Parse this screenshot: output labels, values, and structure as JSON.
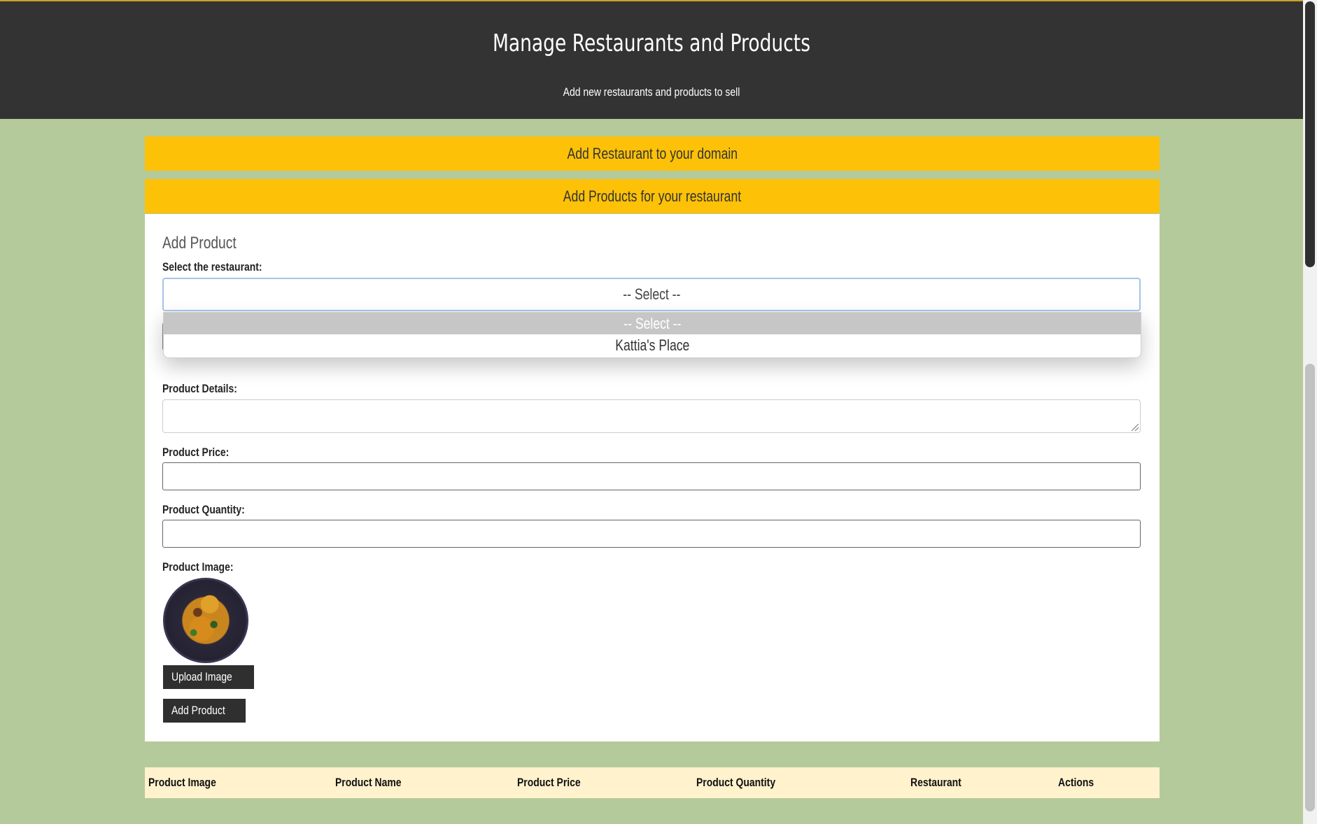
{
  "header": {
    "title": "Manage Restaurants and Products",
    "subtitle": "Add new restaurants and products to sell"
  },
  "accordions": {
    "add_restaurant": "Add Restaurant to your domain",
    "add_products": "Add Products for your restaurant"
  },
  "form": {
    "title": "Add Product",
    "restaurant_label": "Select the restaurant:",
    "restaurant_selected": "-- Select --",
    "restaurant_options": [
      "-- Select --",
      "Kattia's Place"
    ],
    "details_label": "Product Details:",
    "price_label": "Product Price:",
    "quantity_label": "Product Quantity:",
    "image_label": "Product Image:",
    "upload_button": "Upload Image",
    "submit_button": "Add Product"
  },
  "table": {
    "columns": [
      "Product Image",
      "Product Name",
      "Product Price",
      "Product Quantity",
      "Restaurant",
      "Actions"
    ]
  },
  "colors": {
    "header_bg": "#333333",
    "page_bg": "#b5ca9b",
    "accordion_bg": "#fdc108",
    "table_header_bg": "#fff2cd",
    "button_bg": "#2f2f2f"
  }
}
